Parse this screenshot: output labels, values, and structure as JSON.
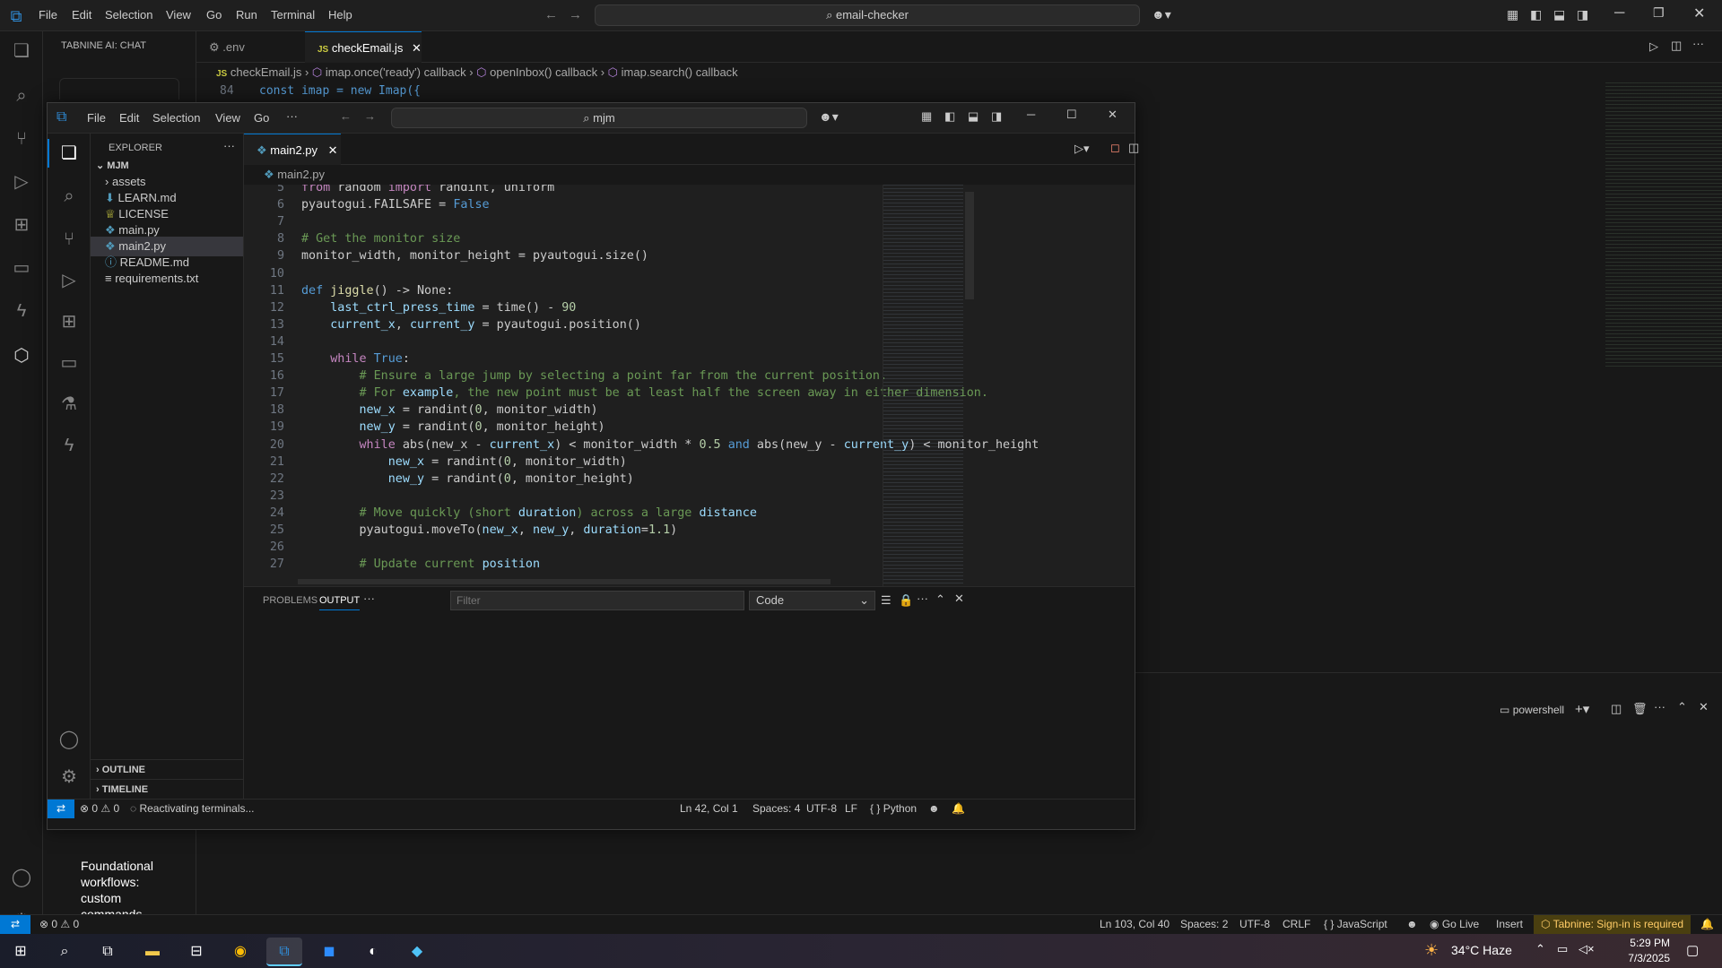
{
  "outer": {
    "menu": [
      "File",
      "Edit",
      "Selection",
      "View",
      "Go",
      "Run",
      "Terminal",
      "Help"
    ],
    "search": "email-checker",
    "side_title": "TABNINE AI: CHAT",
    "tabs": [
      {
        "label": ".env",
        "icon": "gear-icon"
      },
      {
        "label": "checkEmail.js",
        "icon": "js-icon"
      }
    ],
    "breadcrumb": [
      "checkEmail.js",
      "imap.once('ready') callback",
      "openInbox() callback",
      "imap.search() callback"
    ],
    "code": {
      "line_no": "84",
      "text": "const imap = new Imap({"
    },
    "chat_bullet": "Foundational workflows: custom commands, custom chat...",
    "status": {
      "problems": "0",
      "warnings": "0",
      "position": "Ln 103, Col 40",
      "spaces": "Spaces: 2",
      "encoding": "UTF-8",
      "eol": "CRLF",
      "language": "JavaScript",
      "golive": "Go Live",
      "mode": "Insert",
      "tabnine": "Tabnine: Sign-in is required"
    },
    "terminal": {
      "label": "powershell"
    }
  },
  "inner": {
    "menu": [
      "File",
      "Edit",
      "Selection",
      "View",
      "Go"
    ],
    "search": "mjm",
    "explorer_title": "EXPLORER",
    "folder": "MJM",
    "files": [
      {
        "name": "assets",
        "icon": "chevron-right-icon",
        "color": "#cccccc"
      },
      {
        "name": "LEARN.md",
        "icon": "markdown-icon",
        "color": "#519aba"
      },
      {
        "name": "LICENSE",
        "icon": "license-icon",
        "color": "#cbcb41"
      },
      {
        "name": "main.py",
        "icon": "python-icon",
        "color": "#519aba"
      },
      {
        "name": "main2.py",
        "icon": "python-icon",
        "color": "#519aba"
      },
      {
        "name": "README.md",
        "icon": "info-icon",
        "color": "#519aba"
      },
      {
        "name": "requirements.txt",
        "icon": "lines-icon",
        "color": "#cccccc"
      }
    ],
    "outline": "OUTLINE",
    "timeline": "TIMELINE",
    "tab": "main2.py",
    "breadcrumb": "main2.py",
    "code": [
      {
        "n": "5",
        "html": "<span class=\"kw2\">from</span> random <span class=\"kw2\">import</span> randint, uniform"
      },
      {
        "n": "6",
        "html": "pyautogui.FAILSAFE = <span class=\"kw\">False</span>"
      },
      {
        "n": "7",
        "html": ""
      },
      {
        "n": "8",
        "html": "<span class=\"cm\"># Get the monitor size</span>"
      },
      {
        "n": "9",
        "html": "monitor_width, monitor_height = pyautogui.size()"
      },
      {
        "n": "10",
        "html": ""
      },
      {
        "n": "11",
        "html": "<span class=\"def\">def</span> <span class=\"fn\">jiggle</span>() -&gt; None:"
      },
      {
        "n": "12",
        "html": "    <span class=\"var\">last_ctrl_press_time</span> = time() - <span class=\"num\">90</span>"
      },
      {
        "n": "13",
        "html": "    <span class=\"var\">current_x</span>, <span class=\"var\">current_y</span> = pyautogui.position()"
      },
      {
        "n": "14",
        "html": ""
      },
      {
        "n": "15",
        "html": "    <span class=\"kw2\">while</span> <span class=\"kw\">True</span>:"
      },
      {
        "n": "16",
        "html": "        <span class=\"cm\"># Ensure a large jump by selecting a point far from the current position.</span>"
      },
      {
        "n": "17",
        "html": "        <span class=\"cm\"># For <span class=\"var\">example</span>, the new point must be at least half the screen away in either dimension.</span>"
      },
      {
        "n": "18",
        "html": "        <span class=\"var\">new_x</span> = randint(<span class=\"num\">0</span>, monitor_width)"
      },
      {
        "n": "19",
        "html": "        <span class=\"var\">new_y</span> = randint(<span class=\"num\">0</span>, monitor_height)"
      },
      {
        "n": "20",
        "html": "        <span class=\"kw2\">while</span> abs(new_x - <span class=\"var\">current_x</span>) &lt; monitor_width * <span class=\"num\">0.5</span> <span class=\"kw\">and</span> abs(new_y - <span class=\"var\">current_y</span>) &lt; monitor_height"
      },
      {
        "n": "21",
        "html": "            <span class=\"var\">new_x</span> = randint(<span class=\"num\">0</span>, monitor_width)"
      },
      {
        "n": "22",
        "html": "            <span class=\"var\">new_y</span> = randint(<span class=\"num\">0</span>, monitor_height)"
      },
      {
        "n": "23",
        "html": ""
      },
      {
        "n": "24",
        "html": "        <span class=\"cm\"># Move quickly (short <span class=\"var\">duration</span>) across a large <span class=\"var\">distance</span></span>"
      },
      {
        "n": "25",
        "html": "        pyautogui.moveTo(<span class=\"var\">new_x</span>, <span class=\"var\">new_y</span>, <span class=\"var\">duration</span>=<span class=\"num\">1.1</span>)"
      },
      {
        "n": "26",
        "html": ""
      },
      {
        "n": "27",
        "html": "        <span class=\"cm\"># Update current <span class=\"var\">position</span></span>"
      }
    ],
    "panel": {
      "tabs": [
        "PROBLEMS",
        "OUTPUT"
      ],
      "filter_placeholder": "Filter",
      "channel": "Code"
    },
    "status": {
      "problems": "0",
      "warnings": "0",
      "message": "Reactivating terminals...",
      "position": "Ln 42, Col 1",
      "spaces": "Spaces: 4",
      "encoding": "UTF-8",
      "eol": "LF",
      "language": "Python"
    }
  },
  "taskbar": {
    "weather": "34°C  Haze",
    "time": "5:29 PM",
    "date": "7/3/2025",
    "apps": [
      "windows-icon",
      "search-icon",
      "task-view-icon",
      "file-explorer-icon",
      "store-icon",
      "chrome-icon",
      "vscode-icon",
      "zoom-icon",
      "app-icon",
      "app-icon"
    ]
  }
}
